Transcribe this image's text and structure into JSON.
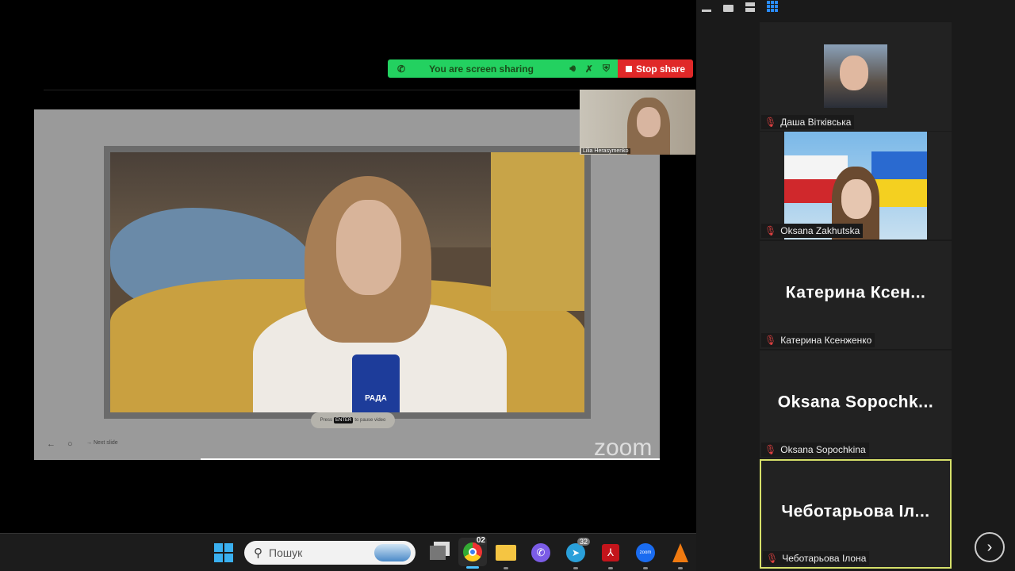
{
  "share_bar": {
    "status": "You are screen sharing",
    "stop_label": "Stop share"
  },
  "shared_screen": {
    "pause_hint_pre": "Press",
    "pause_key": "ENTER",
    "pause_hint_post": "to pause video",
    "next_slide": "Next slide",
    "watermark": "zoom",
    "chest_logo_text": "РАДА"
  },
  "self_view": {
    "name": "Lilia Herasymenko"
  },
  "participants": [
    {
      "name": "Даша Вітківська",
      "type": "photo"
    },
    {
      "name": "Oksana Zakhutska",
      "type": "photo"
    },
    {
      "name": "Катерина Ксенженко",
      "display": "Катерина  Ксен..."
    },
    {
      "name": "Oksana Sopochkina",
      "display": "Oksana  Sopochk..."
    },
    {
      "name": "Чеботарьова Ілона",
      "display": "Чеботарьова Іл...",
      "active_speaker": true
    }
  ],
  "taskbar": {
    "search_placeholder": "Пошук",
    "chrome_badge": "02",
    "telegram_badge": "32",
    "zoom_label": "zoom"
  },
  "colors": {
    "share_green": "#23d160",
    "stop_red": "#e02828",
    "active_border": "#d6e06a"
  }
}
